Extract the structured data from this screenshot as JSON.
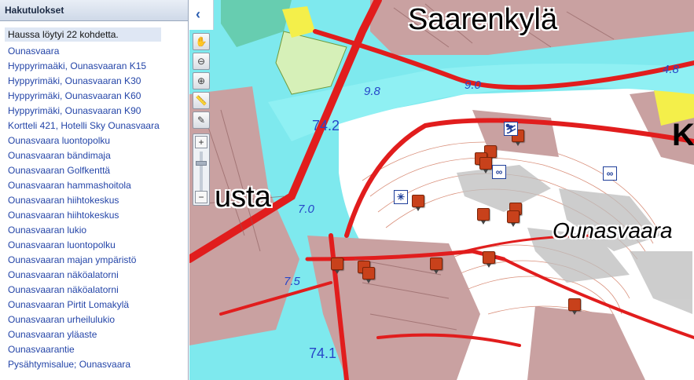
{
  "panel": {
    "title": "Hakutulokset",
    "count_text": "Haussa löytyi 22 kohdetta.",
    "results": [
      "Ounasvaara",
      "Hyppyrimaäki, Ounasvaaran K15",
      "Hyppyrimäki, Ounasvaaran K30",
      "Hyppyrimäki, Ounasvaaran K60",
      "Hyppyrimäki, Ounasvaaran K90",
      "Kortteli 421, Hotelli Sky Ounasvaara",
      "Ounasvaara luontopolku",
      "Ounasvaaran bändimaja",
      "Ounasvaaran Golfkenttä",
      "Ounasvaaran hammashoitola",
      "Ounasvaaran hiihtokeskus",
      "Ounasvaaran hiihtokeskus",
      "Ounasvaaran lukio",
      "Ounasvaaran luontopolku",
      "Ounasvaaran majan ympäristö",
      "Ounasvaaran näköalatorni",
      "Ounasvaaran näköalatorni",
      "Ounasvaaran Pirtit Lomakylä",
      "Ounasvaaran urheilulukio",
      "Ounasvaaran yläaste",
      "Ounasvaarantie",
      "Pysähtymisalue; Ounasvaara"
    ]
  },
  "collapse": {
    "icon": "chevron-left-icon",
    "glyph": "‹"
  },
  "toolbar": {
    "tools": [
      {
        "name": "pan-hand-icon",
        "glyph": "✋"
      },
      {
        "name": "zoom-out-box-icon",
        "glyph": "⊖"
      },
      {
        "name": "zoom-in-box-icon",
        "glyph": "⊕"
      },
      {
        "name": "measure-ruler-icon",
        "glyph": "📏"
      },
      {
        "name": "draw-brush-icon",
        "glyph": "✎"
      }
    ],
    "zoom_in": "+",
    "zoom_out": "−"
  },
  "map": {
    "place_labels": {
      "saarenkyla": "Saarenkylä",
      "usta": "usta",
      "ounasvaara": "Ounasvaara",
      "k": "K"
    },
    "water_labels": {
      "w98": "9.8",
      "w90": "9.0",
      "w48": "4.8",
      "w742": "74.2",
      "w70": "7.0",
      "w75": "7.5",
      "w741": "74.1"
    },
    "colors": {
      "water": "#7ee9ee",
      "road": "#e11d1d",
      "land": "#ffffff",
      "urban": "#c9a1a1",
      "park": "#d6f0b8",
      "marker": "#c8411b"
    }
  }
}
